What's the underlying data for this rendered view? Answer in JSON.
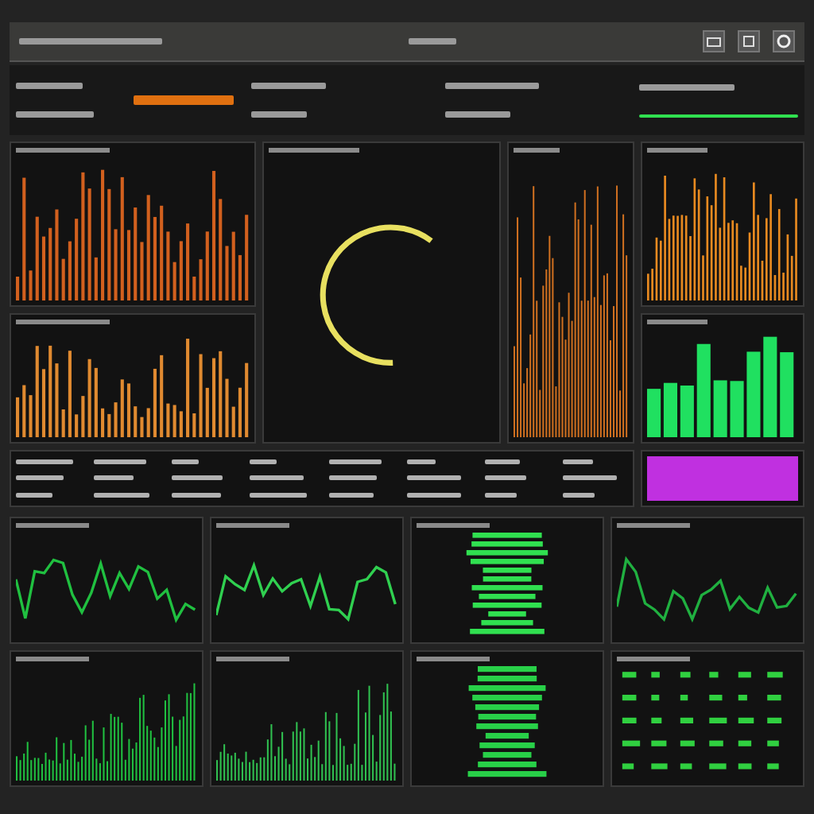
{
  "panels": [
    {
      "kind": "bars",
      "color": "#d2601e"
    },
    {
      "kind": "gauge",
      "color": "#e8e060"
    },
    {
      "kind": "bars",
      "color": "#e88a20"
    },
    {
      "kind": "bars",
      "color": "#e08a30"
    },
    {
      "kind": "bars",
      "color": "#d07020"
    },
    {
      "kind": "blocks",
      "color": "#20e060"
    },
    {
      "kind": "table",
      "color": "#b0b0b0"
    },
    {
      "kind": "fill",
      "color": "#c030e0"
    },
    {
      "kind": "line",
      "color": "#20c040"
    },
    {
      "kind": "line",
      "color": "#30d050"
    },
    {
      "kind": "stripes",
      "color": "#30e050"
    },
    {
      "kind": "line",
      "color": "#20b040"
    },
    {
      "kind": "spikes",
      "color": "#20c040"
    },
    {
      "kind": "spikes",
      "color": "#30c050"
    },
    {
      "kind": "stripes",
      "color": "#28d048"
    },
    {
      "kind": "grid",
      "color": "#30d040"
    }
  ]
}
